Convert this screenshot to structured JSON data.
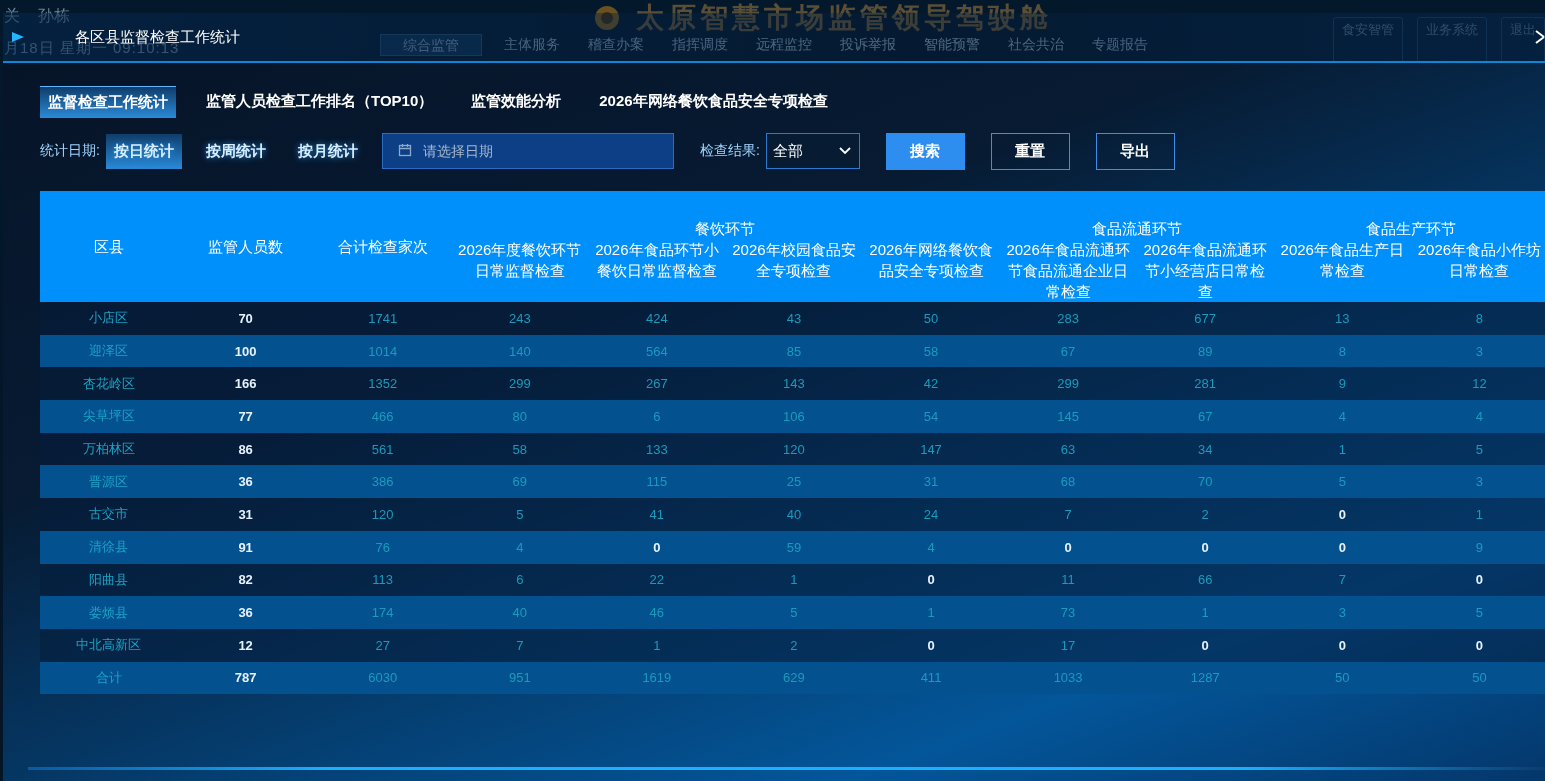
{
  "backdrop": {
    "title": "太原智慧市场监管领导驾驶舱",
    "user": [
      "关",
      "孙栋"
    ],
    "datetime": "月18日 星期一 09:10:13",
    "nav": [
      {
        "label": "综合监管",
        "selected": true
      },
      {
        "label": "主体服务",
        "selected": false
      },
      {
        "label": "稽查办案",
        "selected": false
      },
      {
        "label": "指挥调度",
        "selected": false
      },
      {
        "label": "远程监控",
        "selected": false
      },
      {
        "label": "投诉举报",
        "selected": false
      },
      {
        "label": "智能预警",
        "selected": false
      },
      {
        "label": "社会共治",
        "selected": false
      },
      {
        "label": "专题报告",
        "selected": false
      }
    ],
    "links": [
      "食安智管",
      "业务系统",
      "退出"
    ]
  },
  "dialog": {
    "title": "各区县监督检查工作统计",
    "tabs": [
      {
        "label": "监督检查工作统计",
        "selected": true
      },
      {
        "label": "监管人员检查工作排名（TOP10）",
        "selected": false
      },
      {
        "label": "监管效能分析",
        "selected": false
      },
      {
        "label": "2026年网络餐饮食品安全专项检查",
        "selected": false
      }
    ],
    "filters": {
      "date_label": "统计日期:",
      "periods": [
        {
          "label": "按日统计",
          "selected": true
        },
        {
          "label": "按周统计",
          "selected": false
        },
        {
          "label": "按月统计",
          "selected": false
        }
      ],
      "date_field": {
        "placeholder": "请选择日期"
      },
      "result_label": "检查结果:",
      "result_select": {
        "value": "全部"
      },
      "buttons": [
        {
          "label": "搜索",
          "kind": "primary"
        },
        {
          "label": "重置",
          "kind": "outline"
        },
        {
          "label": "导出",
          "kind": "outline"
        }
      ]
    },
    "table": {
      "header": [
        {
          "label": "区县"
        },
        {
          "label": "监管人员数"
        },
        {
          "label": "合计检查家次"
        },
        {
          "label": "餐饮环节",
          "columns": [
            "2026年度餐饮环节日常监督检查",
            "2026年食品环节小餐饮日常监督检查",
            "2026年校园食品安全专项检查",
            "2026年网络餐饮食品安全专项检查"
          ]
        },
        {
          "label": "食品流通环节",
          "columns": [
            "2026年食品流通环节食品流通企业日常检查",
            "2026年食品流通环节小经营店日常检查"
          ]
        },
        {
          "label": "食品生产环节",
          "columns": [
            "2026年食品生产日常检查",
            "2026年食品小作坊日常检查"
          ]
        }
      ],
      "rows": [
        {
          "district": "小店区",
          "cells": [
            {
              "text": "70",
              "bold": true
            },
            {
              "text": "1741",
              "bold": false
            },
            {
              "text": "243",
              "bold": false
            },
            {
              "text": "424",
              "bold": false
            },
            {
              "text": "43",
              "bold": false
            },
            {
              "text": "50",
              "bold": false
            },
            {
              "text": "283",
              "bold": false
            },
            {
              "text": "677",
              "bold": false
            },
            {
              "text": "13",
              "bold": false
            },
            {
              "text": "8",
              "bold": false
            }
          ]
        },
        {
          "district": "迎泽区",
          "cells": [
            {
              "text": "100",
              "bold": true
            },
            {
              "text": "1014",
              "bold": false
            },
            {
              "text": "140",
              "bold": false
            },
            {
              "text": "564",
              "bold": false
            },
            {
              "text": "85",
              "bold": false
            },
            {
              "text": "58",
              "bold": false
            },
            {
              "text": "67",
              "bold": false
            },
            {
              "text": "89",
              "bold": false
            },
            {
              "text": "8",
              "bold": false
            },
            {
              "text": "3",
              "bold": false
            }
          ]
        },
        {
          "district": "杏花岭区",
          "cells": [
            {
              "text": "166",
              "bold": true
            },
            {
              "text": "1352",
              "bold": false
            },
            {
              "text": "299",
              "bold": false
            },
            {
              "text": "267",
              "bold": false
            },
            {
              "text": "143",
              "bold": false
            },
            {
              "text": "42",
              "bold": false
            },
            {
              "text": "299",
              "bold": false
            },
            {
              "text": "281",
              "bold": false
            },
            {
              "text": "9",
              "bold": false
            },
            {
              "text": "12",
              "bold": false
            }
          ]
        },
        {
          "district": "尖草坪区",
          "cells": [
            {
              "text": "77",
              "bold": true
            },
            {
              "text": "466",
              "bold": false
            },
            {
              "text": "80",
              "bold": false
            },
            {
              "text": "6",
              "bold": false
            },
            {
              "text": "106",
              "bold": false
            },
            {
              "text": "54",
              "bold": false
            },
            {
              "text": "145",
              "bold": false
            },
            {
              "text": "67",
              "bold": false
            },
            {
              "text": "4",
              "bold": false
            },
            {
              "text": "4",
              "bold": false
            }
          ]
        },
        {
          "district": "万柏林区",
          "cells": [
            {
              "text": "86",
              "bold": true
            },
            {
              "text": "561",
              "bold": false
            },
            {
              "text": "58",
              "bold": false
            },
            {
              "text": "133",
              "bold": false
            },
            {
              "text": "120",
              "bold": false
            },
            {
              "text": "147",
              "bold": false
            },
            {
              "text": "63",
              "bold": false
            },
            {
              "text": "34",
              "bold": false
            },
            {
              "text": "1",
              "bold": false
            },
            {
              "text": "5",
              "bold": false
            }
          ]
        },
        {
          "district": "晋源区",
          "cells": [
            {
              "text": "36",
              "bold": true
            },
            {
              "text": "386",
              "bold": false
            },
            {
              "text": "69",
              "bold": false
            },
            {
              "text": "115",
              "bold": false
            },
            {
              "text": "25",
              "bold": false
            },
            {
              "text": "31",
              "bold": false
            },
            {
              "text": "68",
              "bold": false
            },
            {
              "text": "70",
              "bold": false
            },
            {
              "text": "5",
              "bold": false
            },
            {
              "text": "3",
              "bold": false
            }
          ]
        },
        {
          "district": "古交市",
          "cells": [
            {
              "text": "31",
              "bold": true
            },
            {
              "text": "120",
              "bold": false
            },
            {
              "text": "5",
              "bold": false
            },
            {
              "text": "41",
              "bold": false
            },
            {
              "text": "40",
              "bold": false
            },
            {
              "text": "24",
              "bold": false
            },
            {
              "text": "7",
              "bold": false
            },
            {
              "text": "2",
              "bold": false
            },
            {
              "text": "0",
              "bold": true
            },
            {
              "text": "1",
              "bold": false
            }
          ]
        },
        {
          "district": "清徐县",
          "cells": [
            {
              "text": "91",
              "bold": true
            },
            {
              "text": "76",
              "bold": false
            },
            {
              "text": "4",
              "bold": false
            },
            {
              "text": "0",
              "bold": true
            },
            {
              "text": "59",
              "bold": false
            },
            {
              "text": "4",
              "bold": false
            },
            {
              "text": "0",
              "bold": true
            },
            {
              "text": "0",
              "bold": true
            },
            {
              "text": "0",
              "bold": true
            },
            {
              "text": "9",
              "bold": false
            }
          ]
        },
        {
          "district": "阳曲县",
          "cells": [
            {
              "text": "82",
              "bold": true
            },
            {
              "text": "113",
              "bold": false
            },
            {
              "text": "6",
              "bold": false
            },
            {
              "text": "22",
              "bold": false
            },
            {
              "text": "1",
              "bold": false
            },
            {
              "text": "0",
              "bold": true
            },
            {
              "text": "11",
              "bold": false
            },
            {
              "text": "66",
              "bold": false
            },
            {
              "text": "7",
              "bold": false
            },
            {
              "text": "0",
              "bold": true
            }
          ]
        },
        {
          "district": "娄烦县",
          "cells": [
            {
              "text": "36",
              "bold": true
            },
            {
              "text": "174",
              "bold": false
            },
            {
              "text": "40",
              "bold": false
            },
            {
              "text": "46",
              "bold": false
            },
            {
              "text": "5",
              "bold": false
            },
            {
              "text": "1",
              "bold": false
            },
            {
              "text": "73",
              "bold": false
            },
            {
              "text": "1",
              "bold": false
            },
            {
              "text": "3",
              "bold": false
            },
            {
              "text": "5",
              "bold": false
            }
          ]
        },
        {
          "district": "中北高新区",
          "cells": [
            {
              "text": "12",
              "bold": true
            },
            {
              "text": "27",
              "bold": false
            },
            {
              "text": "7",
              "bold": false
            },
            {
              "text": "1",
              "bold": false
            },
            {
              "text": "2",
              "bold": false
            },
            {
              "text": "0",
              "bold": true
            },
            {
              "text": "17",
              "bold": false
            },
            {
              "text": "0",
              "bold": true
            },
            {
              "text": "0",
              "bold": true
            },
            {
              "text": "0",
              "bold": true
            }
          ]
        },
        {
          "district": "合计",
          "cells": [
            {
              "text": "787",
              "bold": true
            },
            {
              "text": "6030",
              "bold": false
            },
            {
              "text": "951",
              "bold": false
            },
            {
              "text": "1619",
              "bold": false
            },
            {
              "text": "629",
              "bold": false
            },
            {
              "text": "411",
              "bold": false
            },
            {
              "text": "1033",
              "bold": false
            },
            {
              "text": "1287",
              "bold": false
            },
            {
              "text": "50",
              "bold": false
            },
            {
              "text": "50",
              "bold": false
            }
          ]
        }
      ]
    }
  }
}
